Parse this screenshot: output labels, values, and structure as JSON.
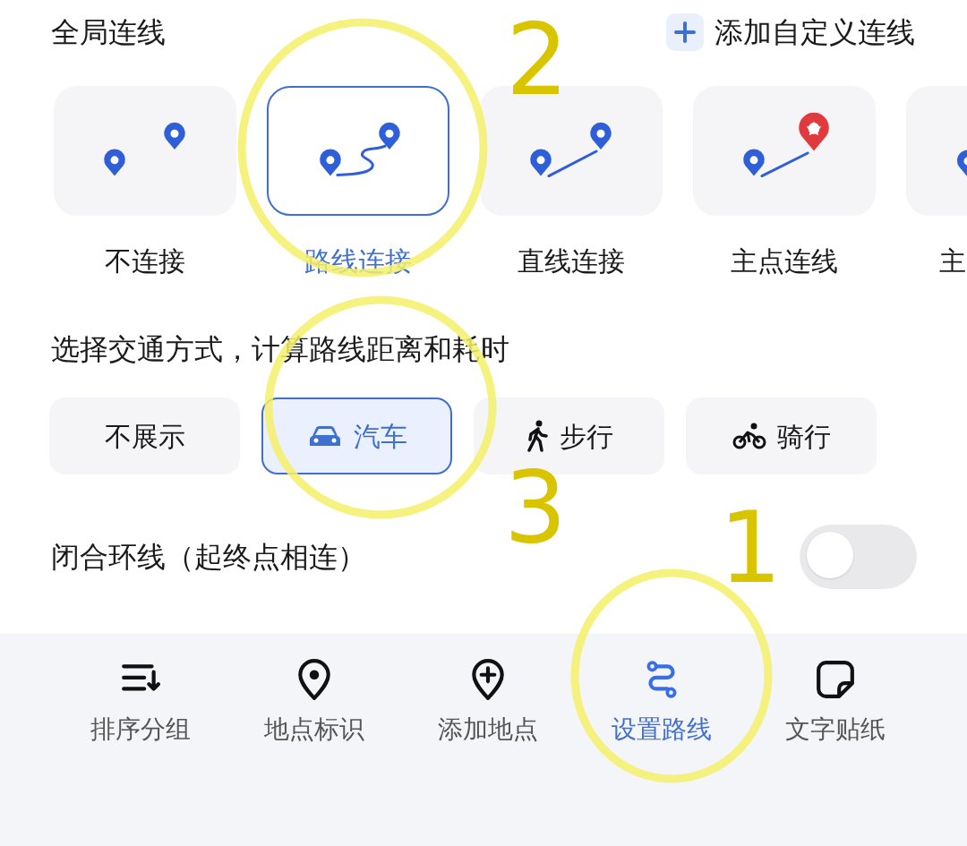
{
  "header": {
    "title": "全局连线",
    "add_button": "添加自定义连线"
  },
  "connection_types": [
    {
      "kind": "none",
      "label": "不连接",
      "selected": false
    },
    {
      "kind": "route",
      "label": "路线连接",
      "selected": true
    },
    {
      "kind": "straight",
      "label": "直线连接",
      "selected": false
    },
    {
      "kind": "main",
      "label": "主点连线",
      "selected": false
    },
    {
      "kind": "partial",
      "label": "主",
      "selected": false
    }
  ],
  "transport_title": "选择交通方式，计算路线距离和耗时",
  "transport_modes": [
    {
      "kind": "none",
      "label": "不展示",
      "selected": false
    },
    {
      "kind": "car",
      "label": "汽车",
      "selected": true
    },
    {
      "kind": "walk",
      "label": "步行",
      "selected": false
    },
    {
      "kind": "bike",
      "label": "骑行",
      "selected": false
    }
  ],
  "loop": {
    "label": "闭合环线（起终点相连）",
    "on": false
  },
  "toolbar": [
    {
      "kind": "sort",
      "label": "排序分组",
      "selected": false
    },
    {
      "kind": "pin",
      "label": "地点标识",
      "selected": false
    },
    {
      "kind": "add",
      "label": "添加地点",
      "selected": false
    },
    {
      "kind": "route",
      "label": "设置路线",
      "selected": true
    },
    {
      "kind": "sticker",
      "label": "文字贴纸",
      "selected": false
    }
  ],
  "annotations": [
    {
      "label": "2"
    },
    {
      "label": "3"
    },
    {
      "label": "1"
    }
  ]
}
